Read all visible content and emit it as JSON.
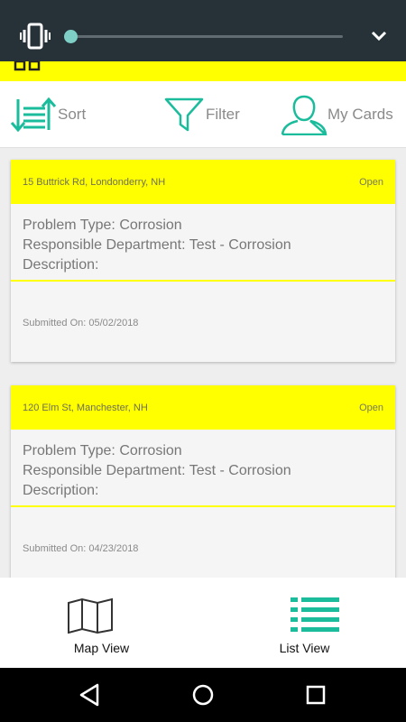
{
  "volume_panel": {
    "level": 0.0,
    "icons": {
      "mode": "vibrate-icon",
      "expand": "chevron-down-icon"
    }
  },
  "toolbar": {
    "sort_label": "Sort",
    "filter_label": "Filter",
    "cards_label": "My Cards"
  },
  "cards": [
    {
      "address": "15 Buttrick Rd, Londonderry, NH",
      "status": "Open",
      "problem_type": "Problem Type: Corrosion",
      "department": "Responsible Department: Test - Corrosion",
      "description": "Description:",
      "submitted": "Submitted On: 05/02/2018"
    },
    {
      "address": "120 Elm St, Manchester, NH",
      "status": "Open",
      "problem_type": "Problem Type: Corrosion",
      "department": "Responsible Department: Test - Corrosion",
      "description": "Description:",
      "submitted": "Submitted On: 04/23/2018"
    }
  ],
  "tabs": {
    "map_label": "Map View",
    "list_label": "List View",
    "active": "List View"
  },
  "colors": {
    "accent": "#1abc9c",
    "highlight": "#ffff00",
    "panel": "#263238"
  }
}
